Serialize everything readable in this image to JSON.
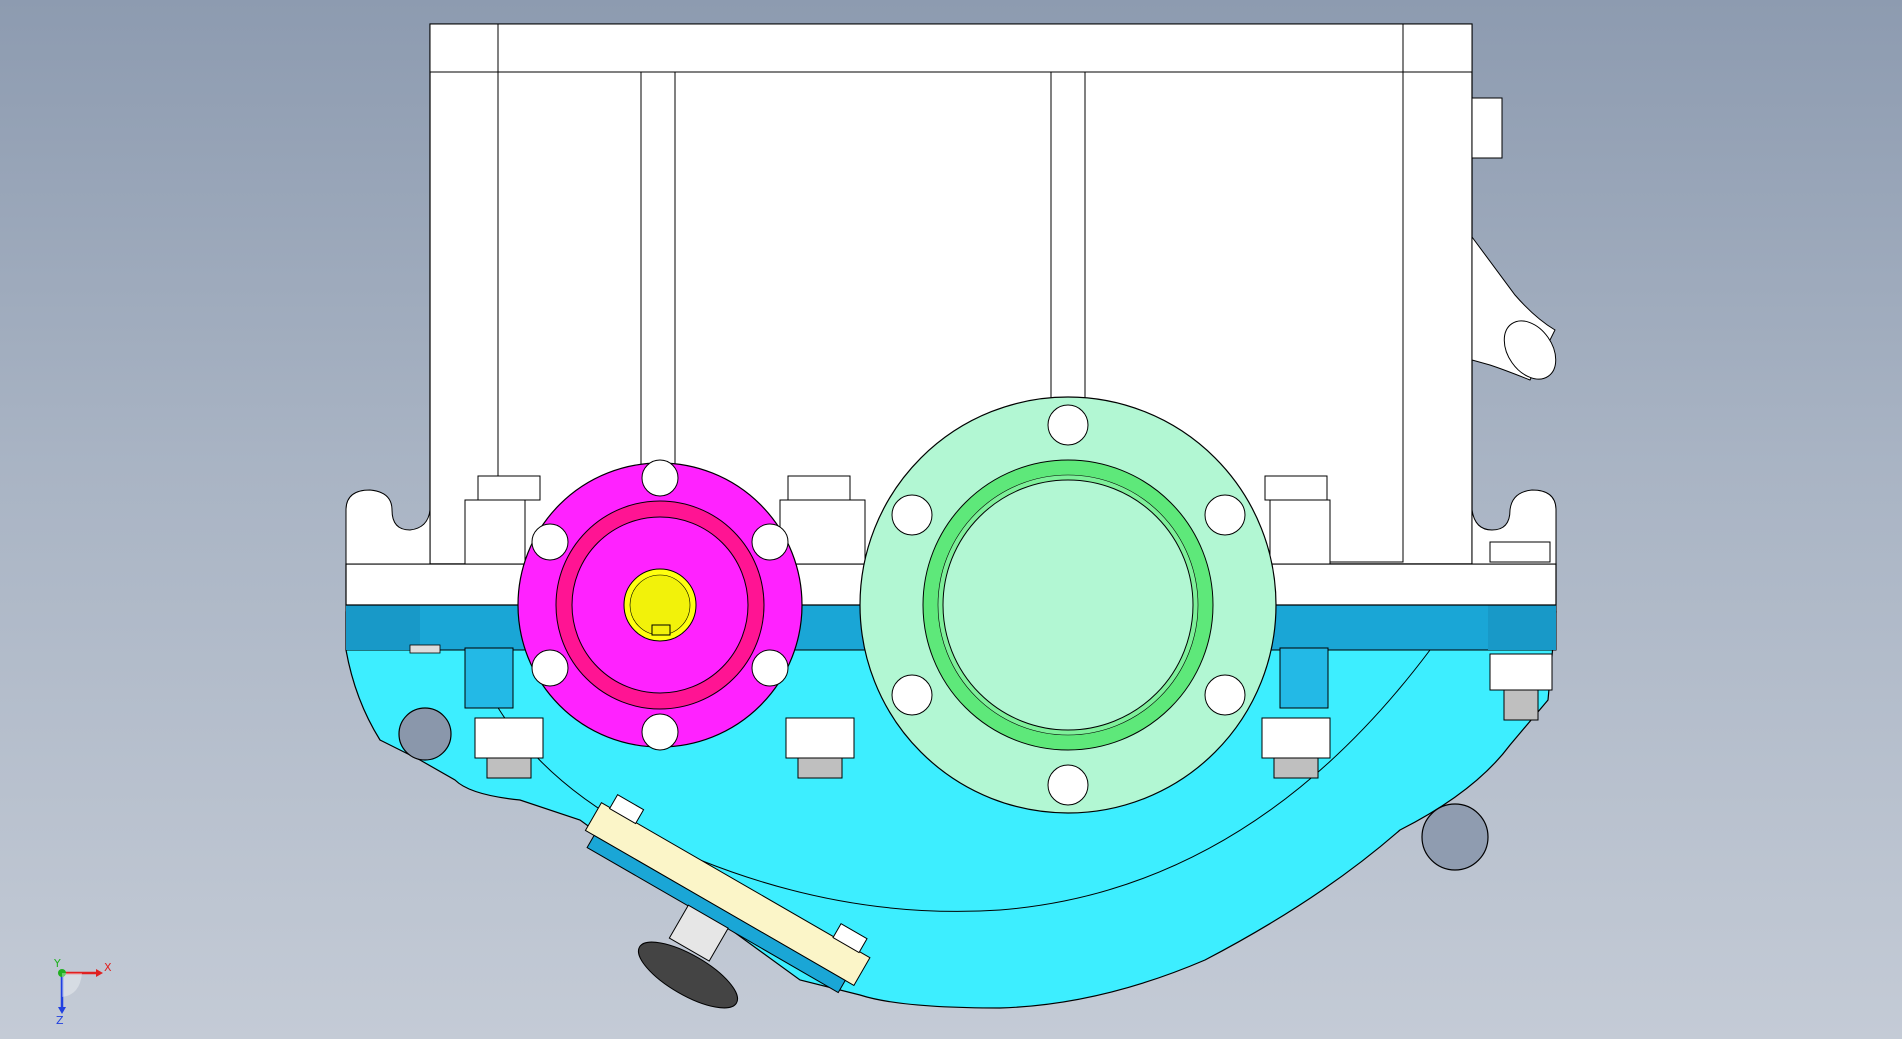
{
  "model": {
    "colors": {
      "housing_upper": "#ffffff",
      "housing_lower": "#3deeff",
      "housing_lower_shade": "#1aa6d6",
      "input_flange": "#ff22ff",
      "input_flange_ring": "#ff1493",
      "input_shaft": "#ffff10",
      "output_cover": "#b2f7d3",
      "output_cover_ring": "#5ee87a",
      "inspection_plate": "#fbf5c8",
      "bolt": "#ffffff",
      "edge": "#000000"
    }
  },
  "triad": {
    "x_label": "X",
    "y_label": "Y",
    "z_label": "Z",
    "x_color": "#e02020",
    "y_color": "#20b020",
    "z_color": "#2040e0"
  }
}
